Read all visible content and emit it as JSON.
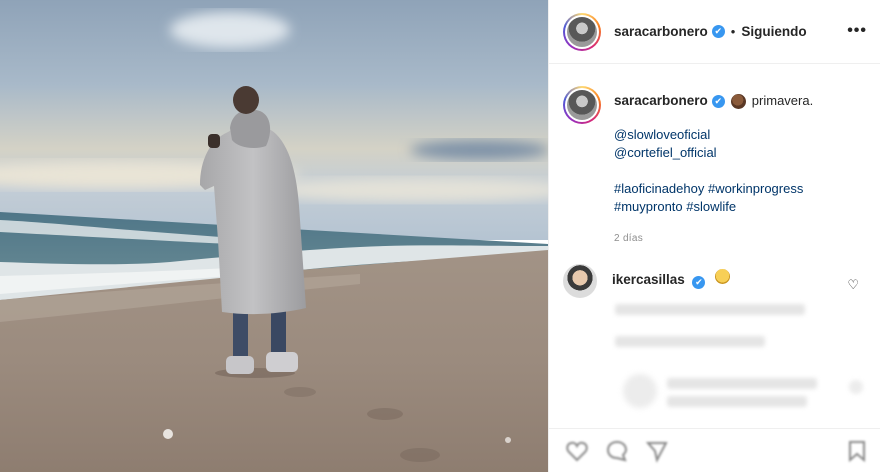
{
  "post": {
    "username": "saracarbonero",
    "separator": "•",
    "follow_status": "Siguiendo",
    "more_label": "•••"
  },
  "caption": {
    "username": "saracarbonero",
    "text": "primavera.",
    "mentions": [
      "@slowloveoficial",
      "@cortefiel_official"
    ],
    "hashtags_line1": "#laoficinadehoy #workinprogress",
    "hashtags_line2": "#muypronto #slowlife",
    "time": "2 días"
  },
  "comment": {
    "username": "ikercasillas"
  },
  "icons": {
    "verified": "✔",
    "heart": "♡"
  },
  "colors": {
    "link": "#003569",
    "verified": "#3897f0",
    "meta": "#8e8e8e"
  }
}
